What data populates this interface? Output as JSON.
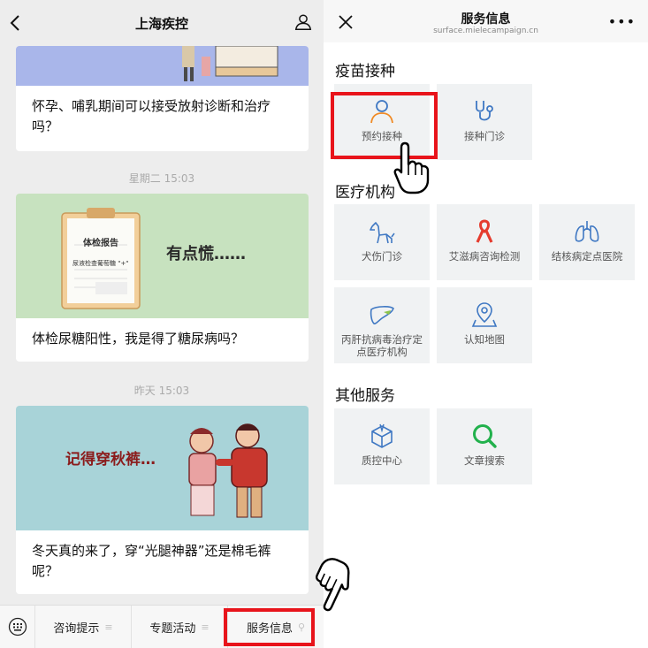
{
  "left": {
    "title": "上海疾控",
    "feed": [
      {
        "text": "怀孕、哺乳期间可以接受放射诊断和治疗吗？"
      },
      {
        "timestamp": "星期二 15:03",
        "image_text_main": "有点慌……",
        "image_text_doc": "体检报告",
        "image_text_line": "尿液检查葡萄糖 \"+\"",
        "text": "体检尿糖阳性，我是得了糖尿病吗？"
      },
      {
        "timestamp": "昨天 15:03",
        "image_text_main": "记得穿秋裤…",
        "text": "冬天真的来了，穿“光腿神器”还是棉毛裤呢？"
      }
    ],
    "menu": [
      {
        "label": "咨询提示",
        "icon": "≡"
      },
      {
        "label": "专题活动",
        "icon": "≡"
      },
      {
        "label": "服务信息",
        "icon": "🔗"
      }
    ]
  },
  "right": {
    "title": "服务信息",
    "subtitle": "surface.mielecampaign.cn",
    "sections": [
      {
        "title": "疫苗接种",
        "tiles": [
          "预约接种",
          "接种门诊"
        ]
      },
      {
        "title": "医疗机构",
        "tiles": [
          "犬伤门诊",
          "艾滋病咨询检测",
          "结核病定点医院",
          "丙肝抗病毒治疗定点医疗机构",
          "认知地图"
        ]
      },
      {
        "title": "其他服务",
        "tiles": [
          "质控中心",
          "文章搜索"
        ]
      }
    ]
  },
  "colors": {
    "accent": "#4a7fc4",
    "highlight": "#e8141b",
    "search": "#22b14c"
  }
}
